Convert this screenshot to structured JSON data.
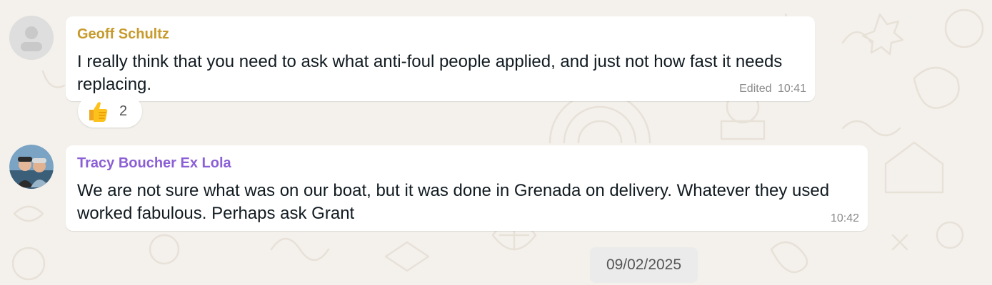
{
  "messages": [
    {
      "sender": "Geoff Schultz",
      "sender_color": "#c79a2c",
      "text": "I really think that you need to ask what anti-foul people applied, and just not how fast it needs replacing.",
      "edited_label": "Edited",
      "time": "10:41",
      "reaction": {
        "emoji": "thumbs-up-icon",
        "count": "2"
      }
    },
    {
      "sender": "Tracy Boucher Ex Lola",
      "sender_color": "#8b5fd6",
      "text": "We are not sure what was on our boat, but it was done in Grenada on delivery.  Whatever they used worked fabulous. Perhaps ask Grant",
      "time": "10:42"
    }
  ],
  "date_separator": "09/02/2025",
  "colors": {
    "background": "#f4f1ec",
    "bubble": "#ffffff"
  }
}
